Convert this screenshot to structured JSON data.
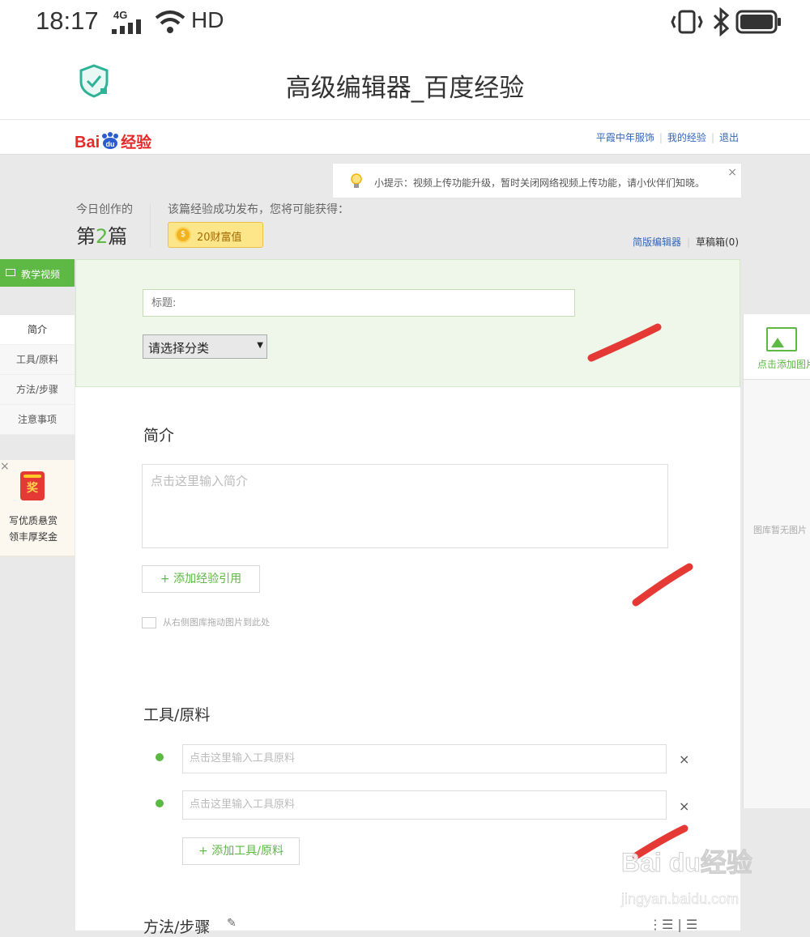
{
  "status_bar": {
    "time": "18:17",
    "network": "4G",
    "hd": "HD"
  },
  "browser": {
    "title": "高级编辑器_百度经验"
  },
  "header": {
    "logo": {
      "part1": "Bai",
      "part2": "du",
      "part3": "经验"
    },
    "links": [
      "平霞中年服饰",
      "我的经验",
      "退出"
    ]
  },
  "tip": {
    "text": "小提示：视频上传功能升级，暂时关闭网络视频上传功能，请小伙伴们知晓。",
    "close": "×"
  },
  "stats": {
    "today_label": "今日创作的",
    "count_prefix": "第",
    "count_value": "2",
    "count_suffix": "篇",
    "reward_label": "该篇经验成功发布，您将可能获得：",
    "reward_coin": "$",
    "reward_value": "20财富值"
  },
  "editor_links": {
    "simple_editor": "简版编辑器",
    "drafts": "草稿箱(0)"
  },
  "left": {
    "video_tab": "教学视频",
    "nav": [
      "简介",
      "工具/原料",
      "方法/步骤",
      "注意事项"
    ],
    "promo": {
      "close": "×",
      "badge": "奖",
      "line1": "写优质悬赏",
      "line2": "领丰厚奖金"
    }
  },
  "main": {
    "title_placeholder": "标题:",
    "category_selected": "请选择分类",
    "intro": {
      "title": "简介",
      "placeholder": "点击这里输入简介",
      "add_ref": "+ 添加经验引用",
      "drag_hint": "从右侧图库拖动图片到此处"
    },
    "tools": {
      "title": "工具/原料",
      "placeholder": "点击这里输入工具原料",
      "remove": "×",
      "add": "+ 添加工具/原料"
    },
    "method": {
      "title": "方法/步骤",
      "edit": "✎",
      "list_icons": "⋮☰ | ☰"
    }
  },
  "gallery": {
    "add_label": "点击添加图片",
    "empty": "图库暂无图片"
  },
  "watermark": {
    "brand": "Bai  du经验",
    "url": "jingyan.baidu.com"
  },
  "colors": {
    "accent_green": "#5db844",
    "link_blue": "#3366bb",
    "stroke_red": "#e53935"
  }
}
